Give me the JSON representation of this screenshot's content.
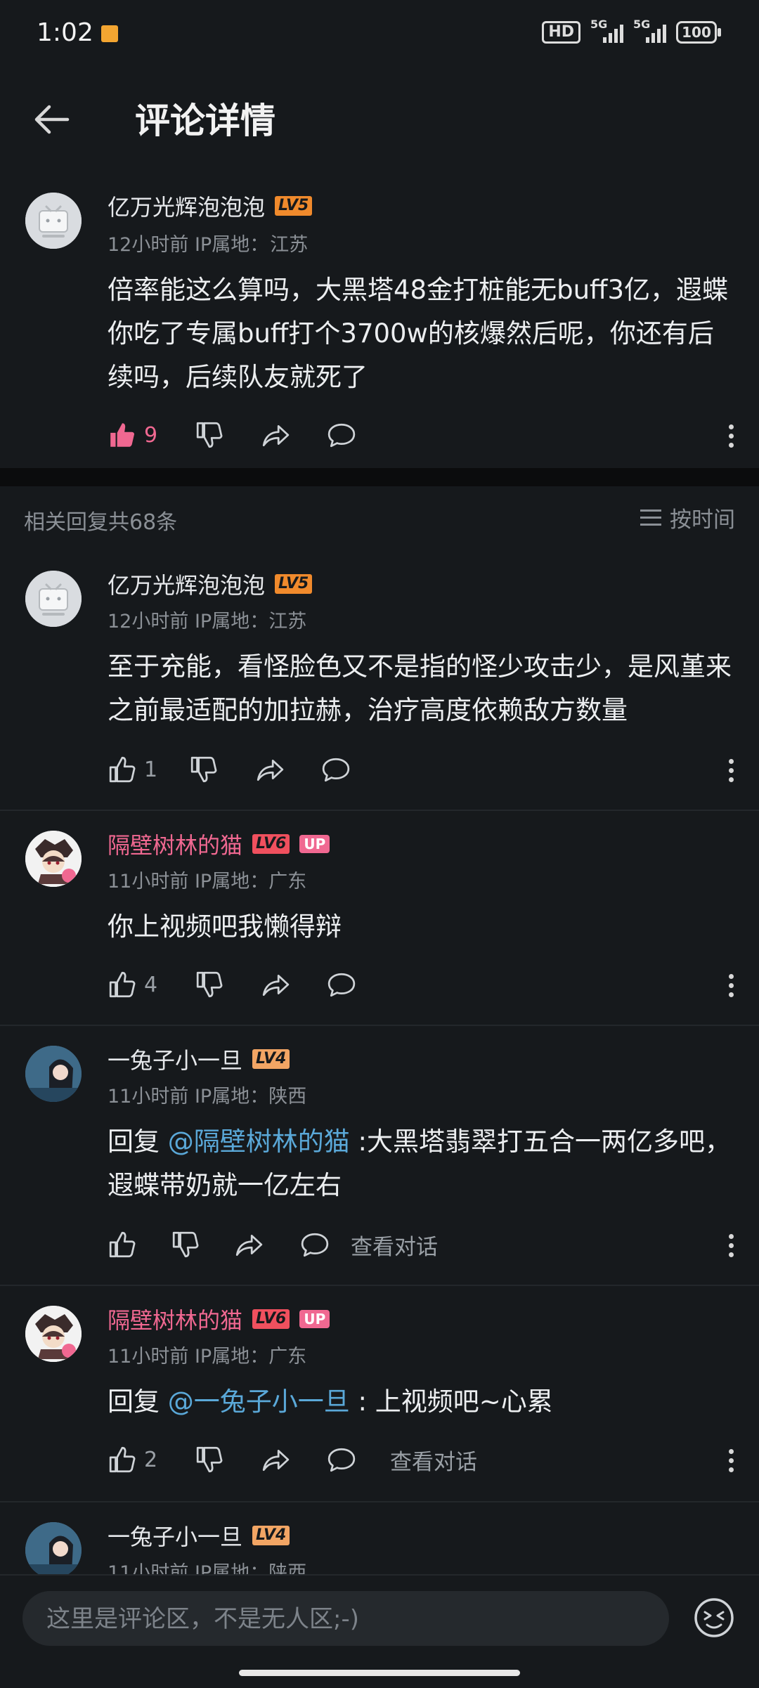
{
  "status": {
    "time": "1:02",
    "hd": "HD",
    "net1": "5G",
    "net2": "5G",
    "battery": "100"
  },
  "header": {
    "title": "评论详情"
  },
  "main_comment": {
    "user": "亿万光辉泡泡泡",
    "level": "LV5",
    "time": "12小时前",
    "ip_label": "IP属地：",
    "ip": "江苏",
    "text": "倍率能这么算吗，大黑塔48金打桩能无buff3亿，遐蝶你吃了专属buff打个3700w的核爆然后呢，你还有后续吗，后续队友就死了",
    "likes": "9"
  },
  "replies_header": {
    "count_text": "相关回复共68条",
    "sort_label": "按时间"
  },
  "replies": [
    {
      "user": "亿万光辉泡泡泡",
      "level": "LV5",
      "time": "12小时前",
      "ip_label": "IP属地：",
      "ip": "江苏",
      "text": "至于充能，看怪脸色又不是指的怪少攻击少，是风堇来之前最适配的加拉赫，治疗高度依赖敌方数量",
      "likes": "1"
    },
    {
      "user": "隔壁树林的猫",
      "level": "LV6",
      "up": "UP",
      "time": "11小时前",
      "ip_label": "IP属地：",
      "ip": "广东",
      "text": "你上视频吧我懒得辩",
      "likes": "4"
    },
    {
      "user": "一兔子小一旦",
      "level": "LV4",
      "time": "11小时前",
      "ip_label": "IP属地：",
      "ip": "陕西",
      "reply_prefix": "回复 ",
      "mention": "@隔壁树林的猫",
      "text": " :大黑塔翡翠打五合一两亿多吧，遐蝶带奶就一亿左右",
      "view_conversation": "查看对话"
    },
    {
      "user": "隔壁树林的猫",
      "level": "LV6",
      "up": "UP",
      "time": "11小时前",
      "ip_label": "IP属地：",
      "ip": "广东",
      "reply_prefix": "回复 ",
      "mention": "@一兔子小一旦",
      "text": " : 上视频吧~心累",
      "likes": "2",
      "view_conversation": "查看对话"
    },
    {
      "user": "一兔子小一旦",
      "level": "LV4",
      "time": "11小时前",
      "ip_label": "IP属地：",
      "ip": "陕西"
    }
  ],
  "input": {
    "placeholder": "这里是评论区，不是无人区;-)"
  },
  "colors": {
    "background": "#16191c",
    "accent_pink": "#f06891",
    "mention_blue": "#5aa8d8"
  },
  "icons": [
    "back-arrow-icon",
    "thumbs-up-icon",
    "thumbs-down-icon",
    "share-icon",
    "comment-icon",
    "more-icon",
    "sort-icon",
    "emoji-icon"
  ]
}
